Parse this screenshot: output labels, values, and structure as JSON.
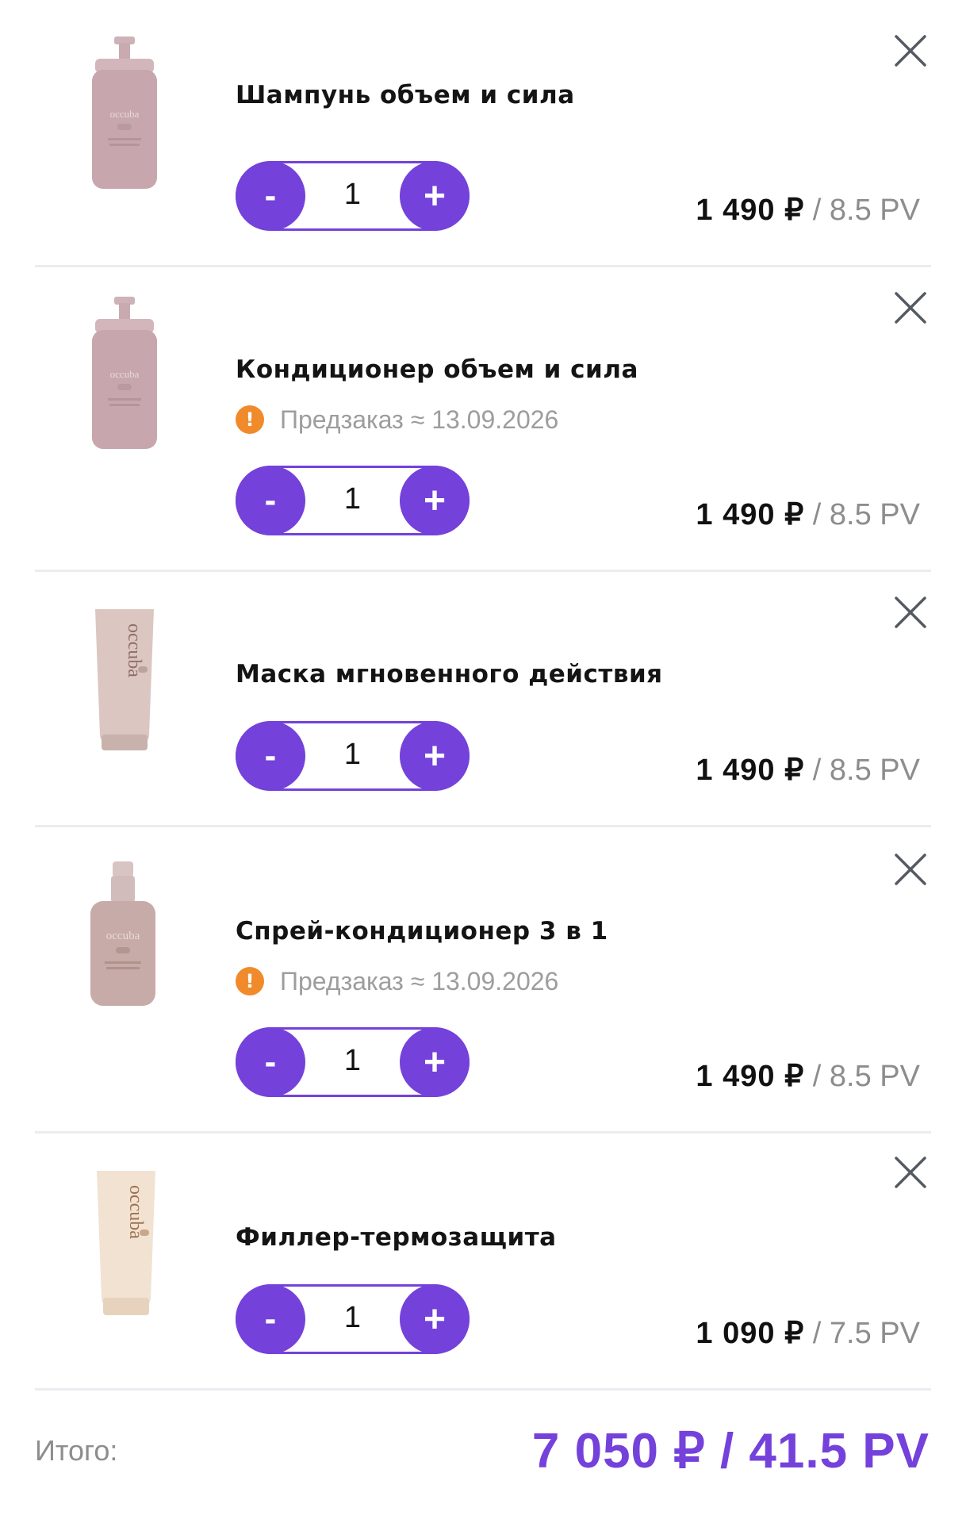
{
  "cart": {
    "items": [
      {
        "image": "shampoo-bottle-image",
        "title": "Шампунь объем и сила",
        "preorder": null,
        "quantity": "1",
        "minus_label": "-",
        "plus_label": "+",
        "price_rub": "1 490 ₽",
        "price_pv": " / 8.5 PV"
      },
      {
        "image": "conditioner-bottle-image",
        "title": "Кондиционер объем и сила",
        "preorder": "Предзаказ ≈ 13.09.2026",
        "quantity": "1",
        "minus_label": "-",
        "plus_label": "+",
        "price_rub": "1 490 ₽",
        "price_pv": " / 8.5 PV"
      },
      {
        "image": "mask-tube-image",
        "title": "Маска мгновенного действия",
        "preorder": null,
        "quantity": "1",
        "minus_label": "-",
        "plus_label": "+",
        "price_rub": "1 490 ₽",
        "price_pv": " / 8.5 PV"
      },
      {
        "image": "spray-bottle-image",
        "title": "Спрей-кондиционер 3 в 1",
        "preorder": "Предзаказ ≈ 13.09.2026",
        "quantity": "1",
        "minus_label": "-",
        "plus_label": "+",
        "price_rub": "1 490 ₽",
        "price_pv": " / 8.5 PV"
      },
      {
        "image": "filler-tube-image",
        "title": "Филлер-термозащита",
        "preorder": null,
        "quantity": "1",
        "minus_label": "-",
        "plus_label": "+",
        "price_rub": "1 090 ₽",
        "price_pv": " / 7.5 PV"
      }
    ],
    "preorder_icon": "!",
    "remove_icon": "close-icon"
  },
  "total": {
    "label": "Итого:",
    "value": "7 050 ₽ / 41.5 PV"
  },
  "colors": {
    "accent": "#7441db",
    "preorder": "#f08a2a",
    "muted": "#8d8d8d",
    "divider": "#ececf0"
  },
  "brand_text": "occuba"
}
